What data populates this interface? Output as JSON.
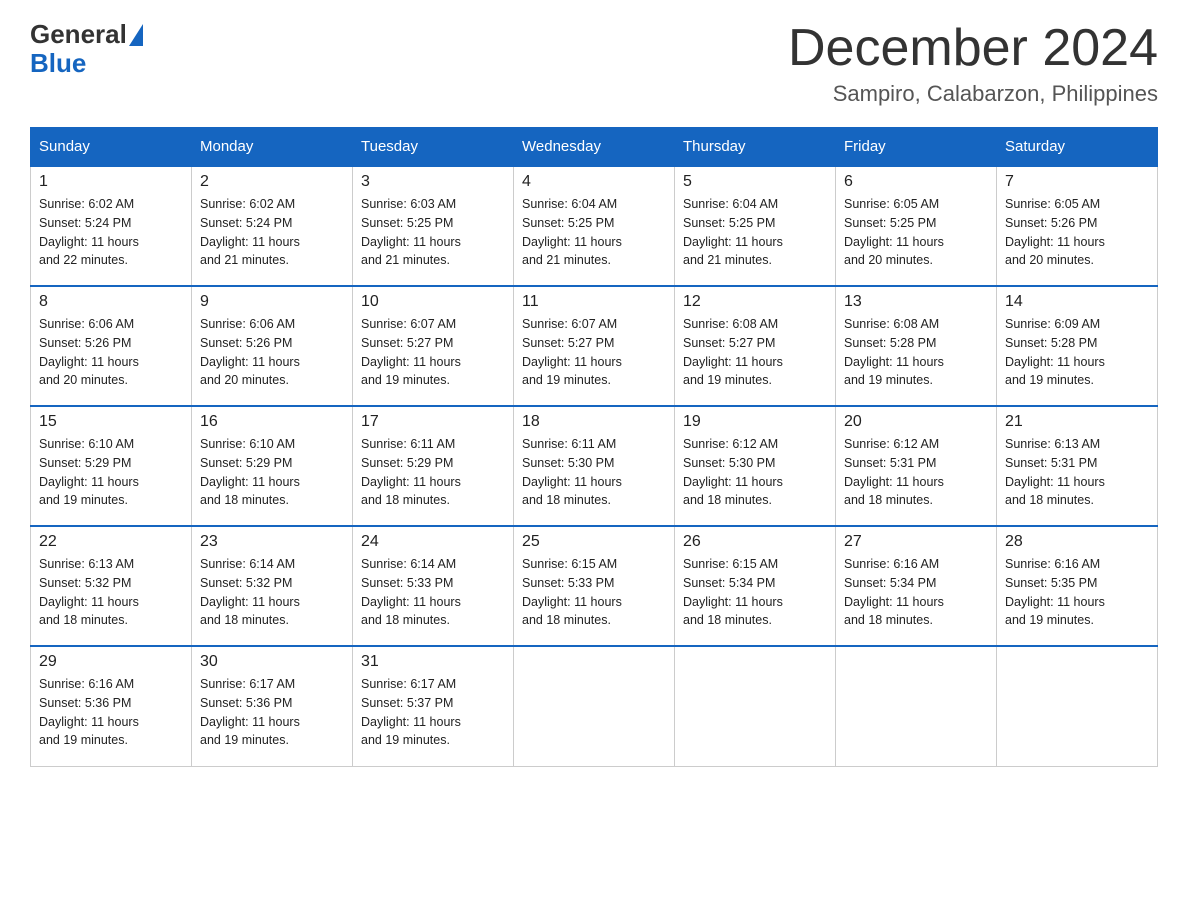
{
  "header": {
    "logo_line1": "General",
    "logo_line2": "Blue",
    "month_title": "December 2024",
    "subtitle": "Sampiro, Calabarzon, Philippines"
  },
  "days_of_week": [
    "Sunday",
    "Monday",
    "Tuesday",
    "Wednesday",
    "Thursday",
    "Friday",
    "Saturday"
  ],
  "weeks": [
    [
      {
        "num": "1",
        "sunrise": "6:02 AM",
        "sunset": "5:24 PM",
        "daylight": "11 hours and 22 minutes."
      },
      {
        "num": "2",
        "sunrise": "6:02 AM",
        "sunset": "5:24 PM",
        "daylight": "11 hours and 21 minutes."
      },
      {
        "num": "3",
        "sunrise": "6:03 AM",
        "sunset": "5:25 PM",
        "daylight": "11 hours and 21 minutes."
      },
      {
        "num": "4",
        "sunrise": "6:04 AM",
        "sunset": "5:25 PM",
        "daylight": "11 hours and 21 minutes."
      },
      {
        "num": "5",
        "sunrise": "6:04 AM",
        "sunset": "5:25 PM",
        "daylight": "11 hours and 21 minutes."
      },
      {
        "num": "6",
        "sunrise": "6:05 AM",
        "sunset": "5:25 PM",
        "daylight": "11 hours and 20 minutes."
      },
      {
        "num": "7",
        "sunrise": "6:05 AM",
        "sunset": "5:26 PM",
        "daylight": "11 hours and 20 minutes."
      }
    ],
    [
      {
        "num": "8",
        "sunrise": "6:06 AM",
        "sunset": "5:26 PM",
        "daylight": "11 hours and 20 minutes."
      },
      {
        "num": "9",
        "sunrise": "6:06 AM",
        "sunset": "5:26 PM",
        "daylight": "11 hours and 20 minutes."
      },
      {
        "num": "10",
        "sunrise": "6:07 AM",
        "sunset": "5:27 PM",
        "daylight": "11 hours and 19 minutes."
      },
      {
        "num": "11",
        "sunrise": "6:07 AM",
        "sunset": "5:27 PM",
        "daylight": "11 hours and 19 minutes."
      },
      {
        "num": "12",
        "sunrise": "6:08 AM",
        "sunset": "5:27 PM",
        "daylight": "11 hours and 19 minutes."
      },
      {
        "num": "13",
        "sunrise": "6:08 AM",
        "sunset": "5:28 PM",
        "daylight": "11 hours and 19 minutes."
      },
      {
        "num": "14",
        "sunrise": "6:09 AM",
        "sunset": "5:28 PM",
        "daylight": "11 hours and 19 minutes."
      }
    ],
    [
      {
        "num": "15",
        "sunrise": "6:10 AM",
        "sunset": "5:29 PM",
        "daylight": "11 hours and 19 minutes."
      },
      {
        "num": "16",
        "sunrise": "6:10 AM",
        "sunset": "5:29 PM",
        "daylight": "11 hours and 18 minutes."
      },
      {
        "num": "17",
        "sunrise": "6:11 AM",
        "sunset": "5:29 PM",
        "daylight": "11 hours and 18 minutes."
      },
      {
        "num": "18",
        "sunrise": "6:11 AM",
        "sunset": "5:30 PM",
        "daylight": "11 hours and 18 minutes."
      },
      {
        "num": "19",
        "sunrise": "6:12 AM",
        "sunset": "5:30 PM",
        "daylight": "11 hours and 18 minutes."
      },
      {
        "num": "20",
        "sunrise": "6:12 AM",
        "sunset": "5:31 PM",
        "daylight": "11 hours and 18 minutes."
      },
      {
        "num": "21",
        "sunrise": "6:13 AM",
        "sunset": "5:31 PM",
        "daylight": "11 hours and 18 minutes."
      }
    ],
    [
      {
        "num": "22",
        "sunrise": "6:13 AM",
        "sunset": "5:32 PM",
        "daylight": "11 hours and 18 minutes."
      },
      {
        "num": "23",
        "sunrise": "6:14 AM",
        "sunset": "5:32 PM",
        "daylight": "11 hours and 18 minutes."
      },
      {
        "num": "24",
        "sunrise": "6:14 AM",
        "sunset": "5:33 PM",
        "daylight": "11 hours and 18 minutes."
      },
      {
        "num": "25",
        "sunrise": "6:15 AM",
        "sunset": "5:33 PM",
        "daylight": "11 hours and 18 minutes."
      },
      {
        "num": "26",
        "sunrise": "6:15 AM",
        "sunset": "5:34 PM",
        "daylight": "11 hours and 18 minutes."
      },
      {
        "num": "27",
        "sunrise": "6:16 AM",
        "sunset": "5:34 PM",
        "daylight": "11 hours and 18 minutes."
      },
      {
        "num": "28",
        "sunrise": "6:16 AM",
        "sunset": "5:35 PM",
        "daylight": "11 hours and 19 minutes."
      }
    ],
    [
      {
        "num": "29",
        "sunrise": "6:16 AM",
        "sunset": "5:36 PM",
        "daylight": "11 hours and 19 minutes."
      },
      {
        "num": "30",
        "sunrise": "6:17 AM",
        "sunset": "5:36 PM",
        "daylight": "11 hours and 19 minutes."
      },
      {
        "num": "31",
        "sunrise": "6:17 AM",
        "sunset": "5:37 PM",
        "daylight": "11 hours and 19 minutes."
      },
      null,
      null,
      null,
      null
    ]
  ],
  "labels": {
    "sunrise": "Sunrise:",
    "sunset": "Sunset:",
    "daylight": "Daylight:"
  }
}
